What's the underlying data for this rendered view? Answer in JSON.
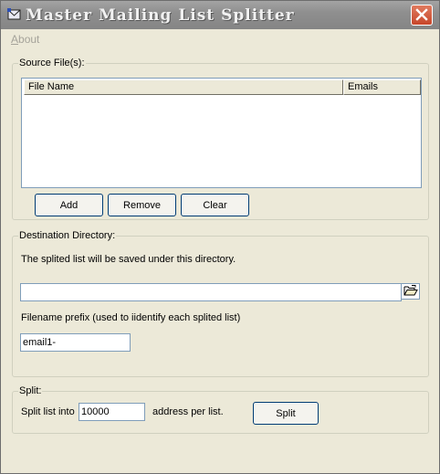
{
  "window": {
    "title": "Master Mailing List Splitter",
    "icons": {
      "app": "app-icon",
      "close": "close-icon",
      "browse": "folder-open-icon"
    }
  },
  "menu": {
    "about_accel": "A",
    "about_rest": "bout"
  },
  "source": {
    "legend": "Source File(s):",
    "columns": [
      {
        "label": "File Name"
      },
      {
        "label": "Emails"
      }
    ],
    "buttons": {
      "add": "Add",
      "remove": "Remove",
      "clear": "Clear"
    }
  },
  "destination": {
    "legend": "Destination Directory:",
    "hint": "The splited list will be saved under this directory.",
    "directory_value": "",
    "prefix_label": "Filename prefix (used to iidentify each splited list)",
    "prefix_value": "email1-"
  },
  "split": {
    "legend": "Split:",
    "label_before": "Split list into",
    "count_value": "10000",
    "label_after": "address per list.",
    "button": "Split"
  }
}
